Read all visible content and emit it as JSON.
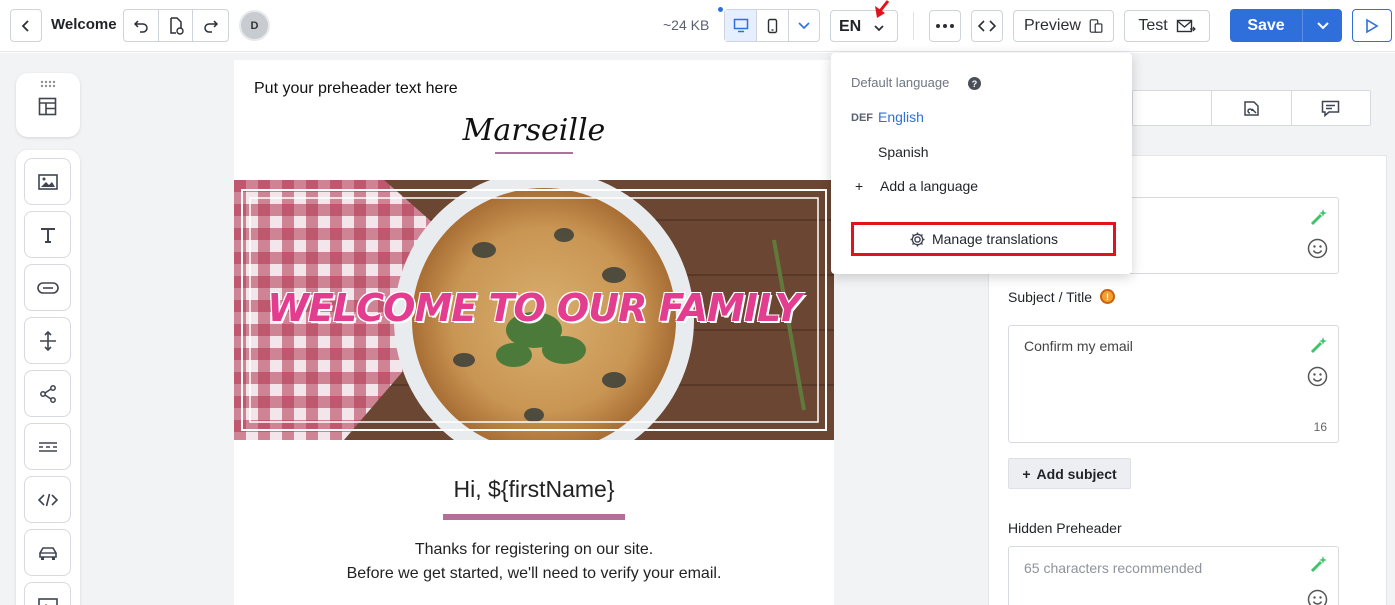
{
  "header": {
    "title": "Welcome",
    "avatar_initial": "D",
    "size": "~24 KB",
    "language_code": "EN",
    "preview_label": "Preview",
    "test_label": "Test",
    "save_label": "Save"
  },
  "language_menu": {
    "heading": "Default language",
    "def_tag": "DEF",
    "languages": [
      "English",
      "Spanish"
    ],
    "add_label": "Add a language",
    "manage_label": "Manage translations"
  },
  "email": {
    "preheader": "Put your preheader text here",
    "logo": "Marseille",
    "hero_headline": "WELCOME TO OUR FAMILY",
    "greeting": "Hi, ${firstName}",
    "body_line1": "Thanks for registering on our site.",
    "body_line2": "Before we get started, we'll need to verify your email."
  },
  "settings": {
    "subject_label": "Subject / Title",
    "subject_value": "Confirm my email",
    "subject_count": "16",
    "add_subject_label": "Add subject",
    "preheader_label": "Hidden Preheader",
    "preheader_placeholder": "65 characters recommended"
  },
  "colors": {
    "accent": "#2f6fdb",
    "highlight": "#e0141c",
    "brand_pink": "#b26f97"
  }
}
